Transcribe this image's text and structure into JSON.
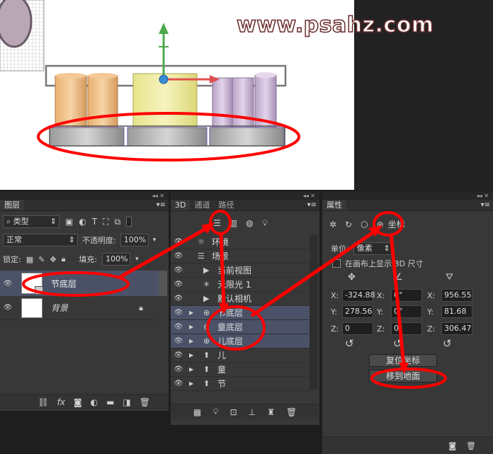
{
  "watermark": "www.psahz.com",
  "layers_panel": {
    "tab": "图层",
    "filter_kind": "类型",
    "blend_mode": "正常",
    "opacity_label": "不透明度:",
    "opacity_value": "100%",
    "lock_label": "锁定:",
    "fill_label": "填充:",
    "fill_value": "100%",
    "layers": [
      {
        "name": "节底层",
        "selected": true
      },
      {
        "name": "背景",
        "selected": false
      }
    ]
  },
  "panel_3d": {
    "tabs": [
      "3D",
      "通道",
      "路径"
    ],
    "items": [
      {
        "label": "环境",
        "indent": 0,
        "icon": "environment-icon",
        "selected": false
      },
      {
        "label": "场景",
        "indent": 0,
        "icon": "scene-icon",
        "selected": false
      },
      {
        "label": "当前视图",
        "indent": 1,
        "icon": "camera-icon",
        "selected": false
      },
      {
        "label": "无限光 1",
        "indent": 1,
        "icon": "light-icon",
        "selected": false
      },
      {
        "label": "默认相机",
        "indent": 1,
        "icon": "camera-icon",
        "selected": false
      },
      {
        "label": "节底层",
        "indent": 1,
        "icon": "mesh-icon",
        "selected": true
      },
      {
        "label": "童底层",
        "indent": 1,
        "icon": "mesh-icon",
        "selected": true
      },
      {
        "label": "儿底层",
        "indent": 1,
        "icon": "mesh-icon",
        "selected": true
      },
      {
        "label": "儿",
        "indent": 1,
        "icon": "text-mesh-icon",
        "selected": false
      },
      {
        "label": "童",
        "indent": 1,
        "icon": "text-mesh-icon",
        "selected": false
      },
      {
        "label": "节",
        "indent": 1,
        "icon": "text-mesh-icon",
        "selected": false
      }
    ]
  },
  "properties_panel": {
    "tab": "属性",
    "section_title": "坐标",
    "unit_label": "单位:",
    "unit_value": "像素",
    "checkbox_label": "在画布上显示 3D 尺寸",
    "position": {
      "x": "-324.88",
      "y": "278.56",
      "z": "0"
    },
    "rotation": {
      "x": "0°",
      "y": "0°",
      "z": "0°"
    },
    "scale": {
      "x": "956.55",
      "y": "81.68",
      "z": "306.47"
    },
    "reset_button": "复位坐标",
    "move_to_ground_button": "移到地面"
  }
}
